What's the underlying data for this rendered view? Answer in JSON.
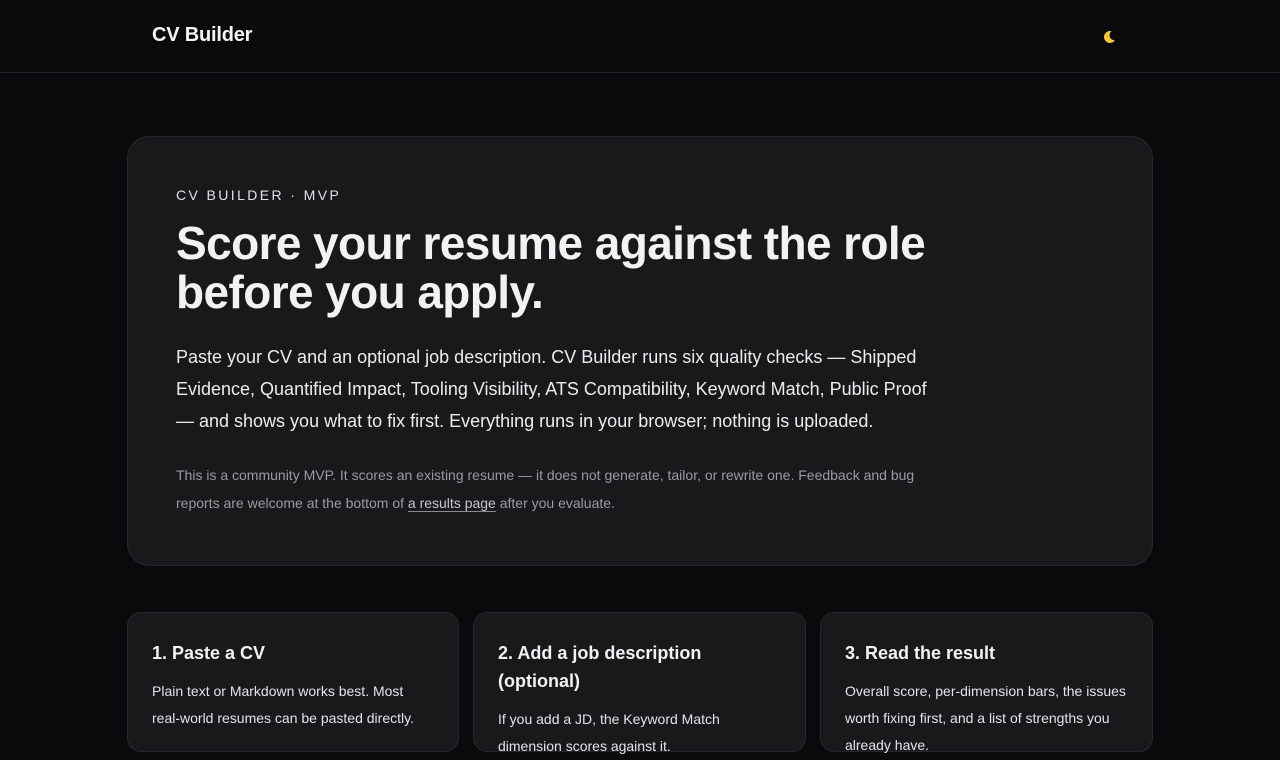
{
  "header": {
    "brand": "CV Builder",
    "theme_icon": "moon-icon"
  },
  "hero": {
    "eyebrow": "CV BUILDER · MVP",
    "title": "Score your resume against the role before you apply.",
    "description": "Paste your CV and an optional job description. CV Builder runs six quality checks — Shipped Evidence, Quantified Impact, Tooling Visibility, ATS Compatibility, Keyword Match, Public Proof — and shows you what to fix first. Everything runs in your browser; nothing is uploaded.",
    "note_before": "This is a community MVP. It scores an existing resume — it does not generate, tailor, or rewrite one. Feedback and bug reports are welcome at the bottom of ",
    "note_link": "a results page",
    "note_after": " after you evaluate."
  },
  "steps": [
    {
      "title": "1. Paste a CV",
      "body": "Plain text or Markdown works best. Most real-world resumes can be pasted directly."
    },
    {
      "title": "2. Add a job description (optional)",
      "body": "If you add a JD, the Keyword Match dimension scores against it."
    },
    {
      "title": "3. Read the result",
      "body": "Overall score, per-dimension bars, the issues worth fixing first, and a list of strengths you already have."
    }
  ]
}
